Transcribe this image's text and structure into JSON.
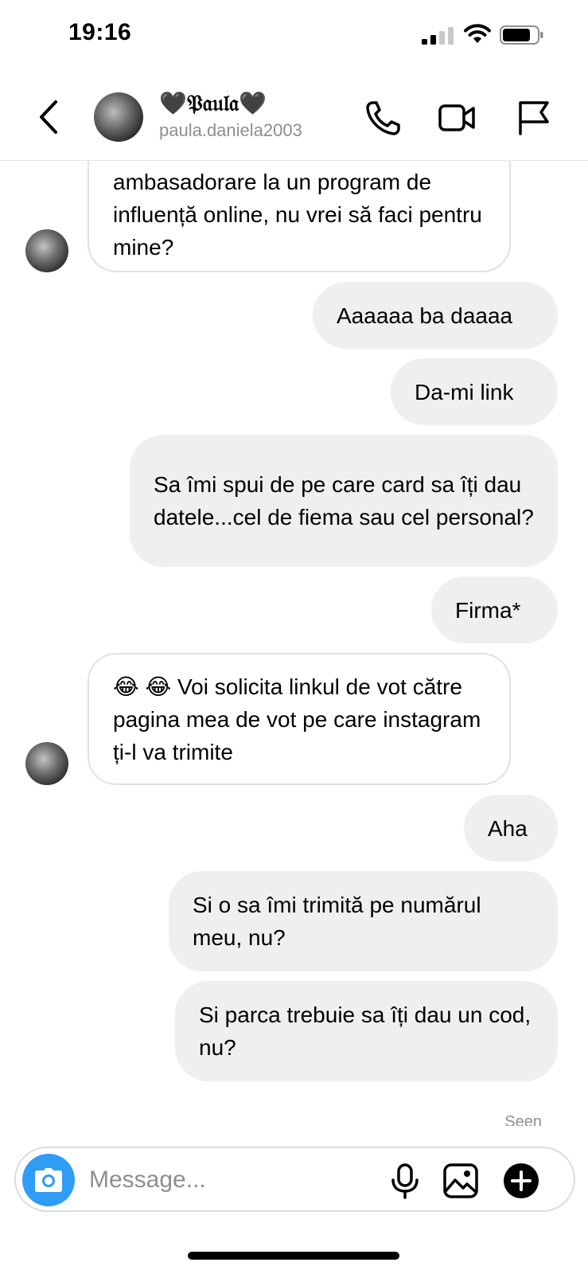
{
  "status_bar": {
    "time": "19:16"
  },
  "header": {
    "display_name": "🖤𝔓𝔞𝔲𝔩𝔞🖤",
    "username": "paula.daniela2003",
    "icons": [
      "back-icon",
      "phone-icon",
      "video-camera-icon",
      "flag-icon"
    ]
  },
  "messages": [
    {
      "sender": "them",
      "text": "ambasadorare la un program de influență online, nu vrei să faci pentru mine?"
    },
    {
      "sender": "me",
      "text": "Aaaaaa ba daaaa"
    },
    {
      "sender": "me",
      "text": "Da-mi link"
    },
    {
      "sender": "me",
      "text": "Sa îmi spui de pe care card sa îți dau datele...cel de fiema sau cel personal?"
    },
    {
      "sender": "me",
      "text": "Firma*"
    },
    {
      "sender": "them",
      "text": "😂 😂 Voi solicita linkul de vot către pagina mea de vot pe care instagram ți-l va trimite"
    },
    {
      "sender": "me",
      "text": "Aha"
    },
    {
      "sender": "me",
      "text": "Si o sa îmi trimită pe numărul meu, nu?"
    },
    {
      "sender": "me",
      "text": "Si parca trebuie sa îți dau un cod, nu?"
    }
  ],
  "seen_label": "Seen",
  "composer": {
    "placeholder": "Message...",
    "icons": [
      "camera-icon",
      "microphone-icon",
      "gallery-icon",
      "plus-icon"
    ]
  },
  "colors": {
    "accent_blue": "#2f9cf5",
    "outgoing_bubble": "#efefef",
    "muted_text": "#8e8e8e"
  }
}
